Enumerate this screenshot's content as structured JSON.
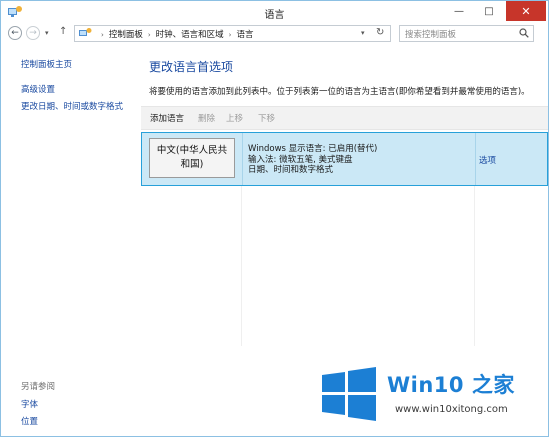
{
  "window": {
    "title": "语言"
  },
  "window_controls": {
    "minimize": "—",
    "maximize": "□",
    "close": "✕"
  },
  "navigation": {
    "back": "←",
    "forward": "→",
    "recent": "▾",
    "up": "↑",
    "refresh": "↻",
    "dropdown": "▾"
  },
  "address": {
    "separator": "›",
    "crumbs": [
      "控制面板",
      "时钟、语言和区域",
      "语言"
    ]
  },
  "search": {
    "placeholder": "搜索控制面板"
  },
  "sidebar": {
    "home": "控制面板主页",
    "links": [
      "高级设置",
      "更改日期、时间或数字格式"
    ],
    "see_also_title": "另请参阅",
    "see_also": [
      "字体",
      "位置"
    ]
  },
  "main": {
    "title": "更改语言首选项",
    "description": "将要使用的语言添加到此列表中。位于列表第一位的语言为主语言(即你希望看到并最常使用的语言)。",
    "toolbar": {
      "add": "添加语言",
      "remove": "删除",
      "move_up": "上移",
      "move_down": "下移"
    },
    "languages": [
      {
        "name": "中文(中华人民共和国)",
        "details": [
          "Windows 显示语言: 已启用(替代)",
          "输入法: 微软五笔, 美式键盘",
          "日期、时间和数字格式"
        ],
        "options": "选项"
      }
    ]
  },
  "watermark": {
    "brand": "Win10 之家",
    "url": "www.win10xitong.com"
  },
  "colors": {
    "accent": "#1a4aa0",
    "selection_bg": "#cbe8f6",
    "selection_border": "#27a0d9",
    "close_button": "#c7352a",
    "watermark_blue": "#1c7fd4"
  }
}
